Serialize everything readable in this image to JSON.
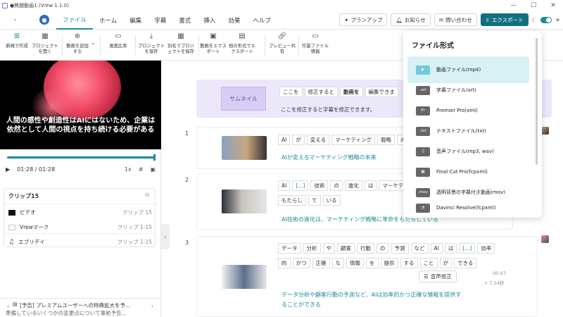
{
  "window": {
    "title": "●無題動画1 (Vrew 1.1.0)"
  },
  "menu": {
    "tabs": [
      "ファイル",
      "ホーム",
      "編集",
      "字幕",
      "書式",
      "挿入",
      "効果",
      "ヘルプ"
    ],
    "plan_label": "プランアップ",
    "notice_label": "お知らせ",
    "contact_label": "問い合わせ",
    "export_label": "エクスポート"
  },
  "toolbar": {
    "new": "新規で作成",
    "open": "プロジェクトを開く",
    "add_video": "動画を追加する",
    "ratio": "画面比率",
    "save": "プロジェクトを保存",
    "save_as": "別名でプロジェクトを保存",
    "export_video": "動画をエクスポート",
    "export_other": "他の形式でエクスポート",
    "preview": "プレビュー共有",
    "work_info": "作業ファイル情報"
  },
  "preview": {
    "subtitle": "人間の感性や創造性はAIにはないため、企業は依然として人間の視点を持ち続ける必要がある",
    "time": "01:28 / 01:28",
    "speed": "1x"
  },
  "clip_panel": {
    "title": "クリップ15",
    "rows": [
      {
        "label": "ビデオ",
        "value": "クリップ 15"
      },
      {
        "label": "Vrewマーク",
        "value": "クリップ 1-15"
      },
      {
        "label": "エブリデイ",
        "value": "クリップ 1-15"
      }
    ]
  },
  "news": {
    "title": "[予告] プレミアムユーザーへの特典拡大を予...",
    "body": "準備しているいくつかの変更点について事前予告..."
  },
  "editor": {
    "thumbnail_label": "サムネイル",
    "thumb_words": [
      "ここを",
      "修正すると",
      "動画を",
      "編集できま"
    ],
    "thumb_hint": "ここを修正すると字幕を修正できます。",
    "rows": [
      {
        "num": "1",
        "words": [
          "AI",
          "が",
          "変える",
          "マーケティング",
          "戦略",
          "の",
          "未"
        ],
        "text": "AIが変えるマーケティング戦略の未来"
      },
      {
        "num": "2",
        "words": [
          "AI",
          "[...]",
          "技術",
          "の",
          "進化",
          "は",
          "マーケティング"
        ],
        "words2": [
          "もたらし",
          "て",
          "いる"
        ],
        "text": "AI技術の進化は、マーケティング戦略に革命をもたらしている"
      },
      {
        "num": "3",
        "words": [
          "データ",
          "分析",
          "や",
          "顧客",
          "行動",
          "の",
          "予測",
          "など",
          "AI",
          "は",
          "[...]",
          "効率"
        ],
        "words2": [
          "的",
          "かつ",
          "正確",
          "な",
          "情報",
          "を",
          "提供",
          "する",
          "こと",
          "が",
          "できる"
        ],
        "text": "データ分析や顧客行動の予測など、AIは効率的かつ正確な情報を提供することができる",
        "voice_fix": "音声修正",
        "duration": "00:07",
        "plus": "+ 7.54秒"
      }
    ]
  },
  "export_panel": {
    "title": "ファイル形式",
    "options": [
      {
        "icon": "▶",
        "label": "動画ファイル(mp4)"
      },
      {
        "icon": ".srt",
        "label": "字幕ファイル(srt)"
      },
      {
        "icon": "Pr",
        "label": "Premier Pro(xml)"
      },
      {
        "icon": ".txt",
        "label": "テキストファイル(txt)"
      },
      {
        "icon": "♫",
        "label": "音声ファイル(mp3, wav)"
      },
      {
        "icon": "▦",
        "label": "Final Cut Pro(fcpxml)"
      },
      {
        "icon": ".mov",
        "label": "透明背景の字幕付き動画(mov)"
      },
      {
        "icon": "◔",
        "label": "Davinci Resolve(fcpxml)"
      }
    ]
  },
  "colors": {
    "accent": "#1d8b99",
    "export_btn": "#12707e",
    "selected_option": "#d7f1f5",
    "thumbnail_bg": "#ece7fb"
  }
}
